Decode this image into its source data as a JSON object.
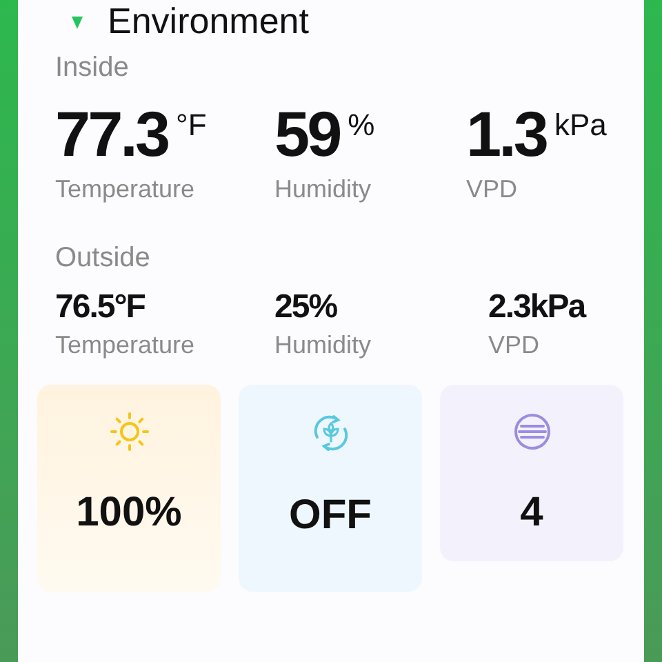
{
  "header": {
    "title": "Environment"
  },
  "inside": {
    "label": "Inside",
    "readings": [
      {
        "value": "77.3",
        "unit": "°F",
        "label": "Temperature"
      },
      {
        "value": "59",
        "unit": "%",
        "label": "Humidity"
      },
      {
        "value": "1.3",
        "unit": "kPa",
        "label": "VPD"
      }
    ]
  },
  "outside": {
    "label": "Outside",
    "readings": [
      {
        "value": "76.5°F",
        "label": "Temperature"
      },
      {
        "value": "25%",
        "label": "Humidity"
      },
      {
        "value": "2.3kPa",
        "label": "VPD"
      }
    ]
  },
  "tiles": [
    {
      "kind": "light",
      "value": "100%"
    },
    {
      "kind": "circulation",
      "value": "OFF"
    },
    {
      "kind": "fan",
      "value": "4"
    }
  ]
}
